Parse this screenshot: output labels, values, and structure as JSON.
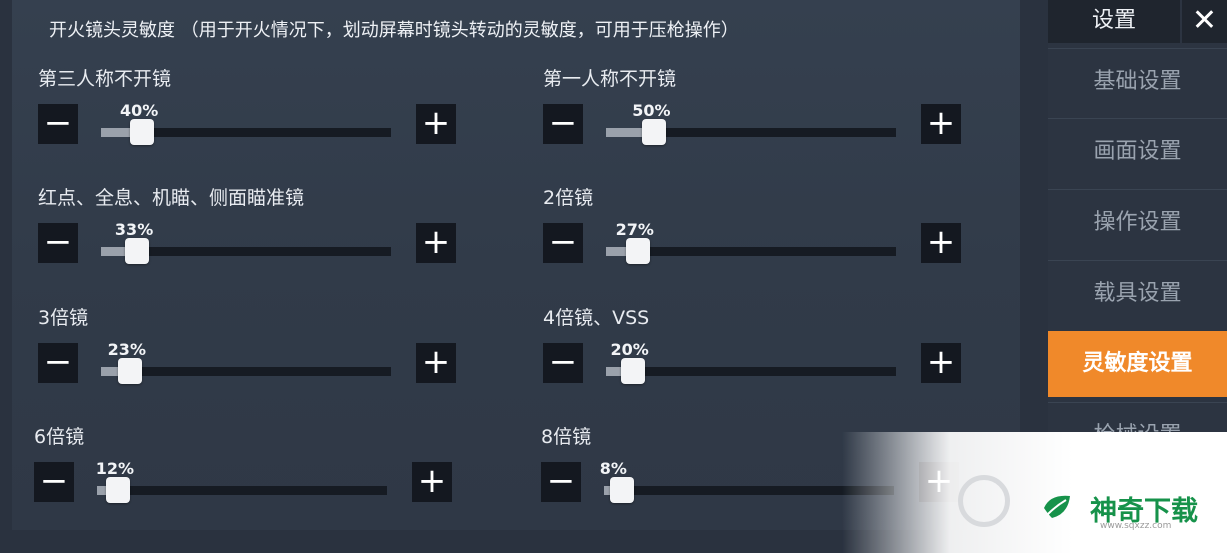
{
  "panel": {
    "title": "开火镜头灵敏度 （用于开火情况下，划动屏幕时镜头转动的灵敏度，可用于压枪操作）",
    "settings": [
      {
        "label": "第三人称不开镜",
        "value_text": "40%",
        "value": 40
      },
      {
        "label": "第一人称不开镜",
        "value_text": "50%",
        "value": 50
      },
      {
        "label": "红点、全息、机瞄、侧面瞄准镜",
        "value_text": "33%",
        "value": 33
      },
      {
        "label": "2倍镜",
        "value_text": "27%",
        "value": 27
      },
      {
        "label": "3倍镜",
        "value_text": "23%",
        "value": 23
      },
      {
        "label": "4倍镜、VSS",
        "value_text": "20%",
        "value": 20
      },
      {
        "label": "6倍镜",
        "value_text": "12%",
        "value": 12
      },
      {
        "label": "8倍镜",
        "value_text": "8%",
        "value": 8
      }
    ],
    "minus_symbol": "−",
    "plus_symbol": "+"
  },
  "sidebar": {
    "title": "设置",
    "close_symbol": "✕",
    "items": [
      {
        "label": "基础设置",
        "active": false
      },
      {
        "label": "画面设置",
        "active": false
      },
      {
        "label": "操作设置",
        "active": false
      },
      {
        "label": "载具设置",
        "active": false
      },
      {
        "label": "灵敏度设置",
        "active": true
      },
      {
        "label": "枪械设置",
        "active": false
      }
    ]
  },
  "watermark": {
    "brand": "神奇下载",
    "url": "www.sqxzz.com"
  },
  "colors": {
    "accent": "#f0892a",
    "button_bg": "#141820",
    "panel_bg": "#35404f",
    "watermark_green": "#16924a"
  }
}
